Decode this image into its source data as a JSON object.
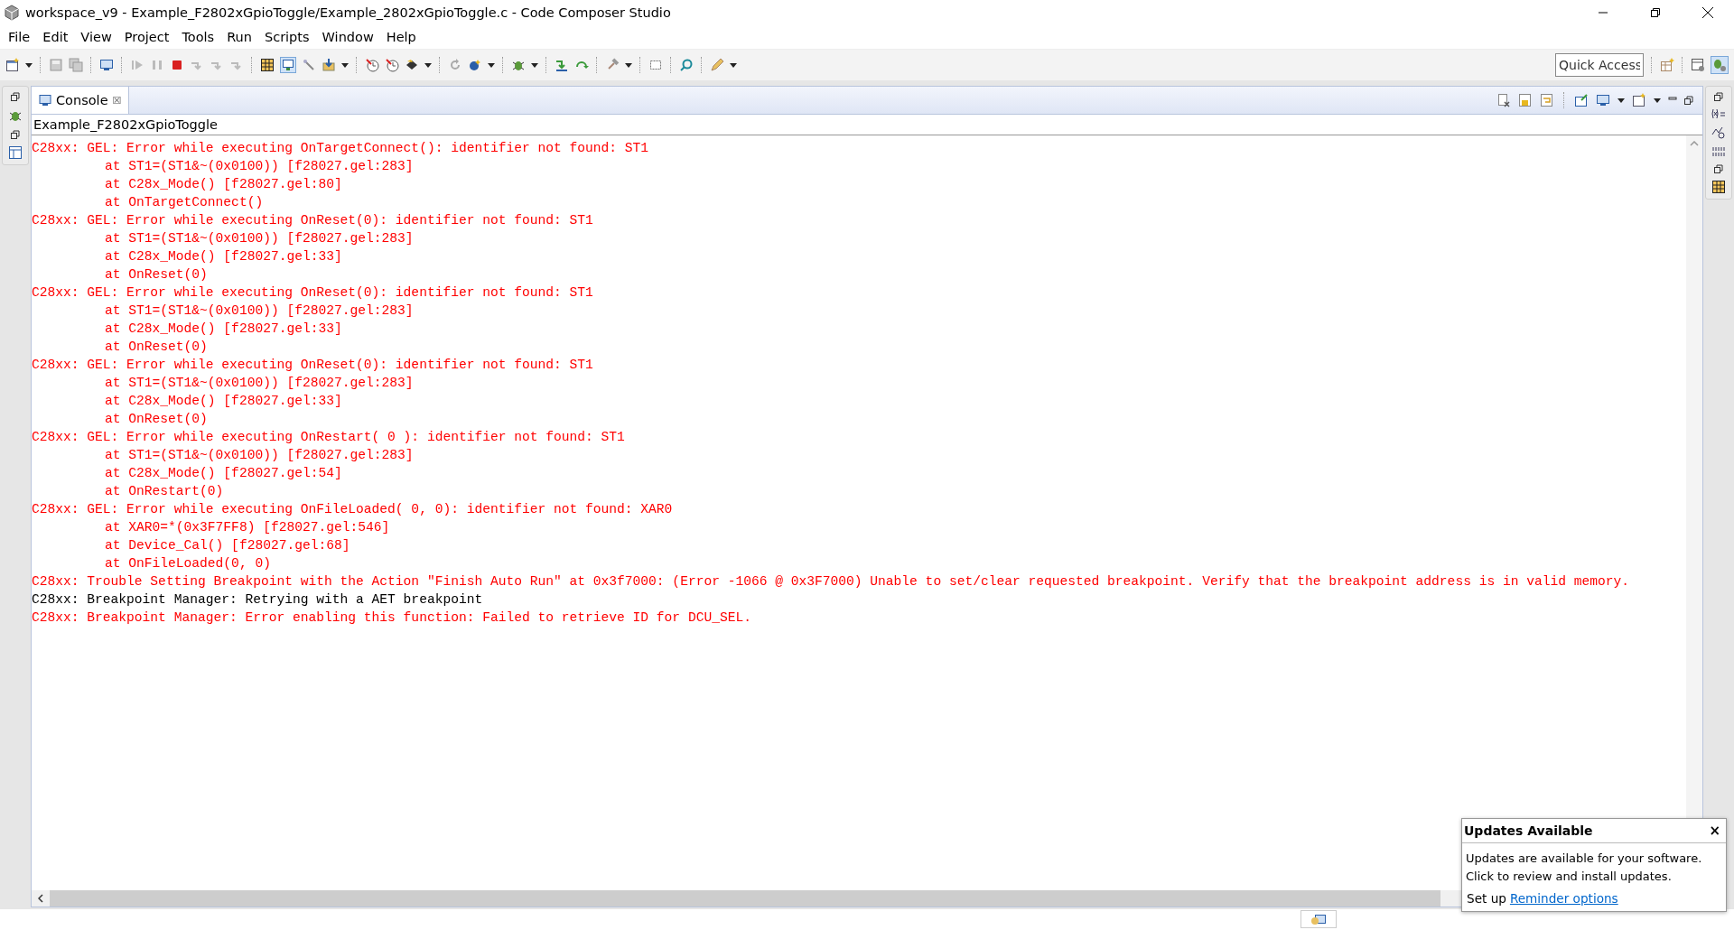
{
  "window": {
    "title": "workspace_v9 - Example_F2802xGpioToggle/Example_2802xGpioToggle.c - Code Composer Studio"
  },
  "menu": [
    "File",
    "Edit",
    "View",
    "Project",
    "Tools",
    "Run",
    "Scripts",
    "Window",
    "Help"
  ],
  "quick_access": {
    "placeholder": "Quick Access"
  },
  "console": {
    "tab": {
      "label": "Console",
      "close": "☒"
    },
    "subtitle": "Example_F2802xGpioToggle",
    "lines": [
      {
        "kind": "error",
        "text": "C28xx: GEL: Error while executing OnTargetConnect(): identifier not found: ST1"
      },
      {
        "kind": "trace",
        "text": "at ST1=(ST1&~(0x0100)) [f28027.gel:283]"
      },
      {
        "kind": "trace",
        "text": "at C28x_Mode() [f28027.gel:80]"
      },
      {
        "kind": "trace",
        "text": "at OnTargetConnect()"
      },
      {
        "kind": "error",
        "text": "C28xx: GEL: Error while executing OnReset(0): identifier not found: ST1"
      },
      {
        "kind": "trace",
        "text": "at ST1=(ST1&~(0x0100)) [f28027.gel:283]"
      },
      {
        "kind": "trace",
        "text": "at C28x_Mode() [f28027.gel:33]"
      },
      {
        "kind": "trace",
        "text": "at OnReset(0)"
      },
      {
        "kind": "error",
        "text": "C28xx: GEL: Error while executing OnReset(0): identifier not found: ST1"
      },
      {
        "kind": "trace",
        "text": "at ST1=(ST1&~(0x0100)) [f28027.gel:283]"
      },
      {
        "kind": "trace",
        "text": "at C28x_Mode() [f28027.gel:33]"
      },
      {
        "kind": "trace",
        "text": "at OnReset(0)"
      },
      {
        "kind": "error",
        "text": "C28xx: GEL: Error while executing OnReset(0): identifier not found: ST1"
      },
      {
        "kind": "trace",
        "text": "at ST1=(ST1&~(0x0100)) [f28027.gel:283]"
      },
      {
        "kind": "trace",
        "text": "at C28x_Mode() [f28027.gel:33]"
      },
      {
        "kind": "trace",
        "text": "at OnReset(0)"
      },
      {
        "kind": "error",
        "text": "C28xx: GEL: Error while executing OnRestart( 0 ): identifier not found: ST1"
      },
      {
        "kind": "trace",
        "text": "at ST1=(ST1&~(0x0100)) [f28027.gel:283]"
      },
      {
        "kind": "trace",
        "text": "at C28x_Mode() [f28027.gel:54]"
      },
      {
        "kind": "trace",
        "text": "at OnRestart(0)"
      },
      {
        "kind": "error",
        "text": "C28xx: GEL: Error while executing OnFileLoaded( 0, 0): identifier not found: XAR0"
      },
      {
        "kind": "trace",
        "text": "at XAR0=*(0x3F7FF8) [f28027.gel:546]"
      },
      {
        "kind": "trace",
        "text": "at Device_Cal() [f28027.gel:68]"
      },
      {
        "kind": "trace",
        "text": "at OnFileLoaded(0, 0)"
      },
      {
        "kind": "error",
        "text": "C28xx: Trouble Setting Breakpoint with the Action \"Finish Auto Run\" at 0x3f7000: (Error -1066 @ 0x3F7000) Unable to set/clear requested breakpoint. Verify that the breakpoint address is in valid memory."
      },
      {
        "kind": "info",
        "text": "C28xx: Breakpoint Manager: Retrying with a AET breakpoint"
      },
      {
        "kind": "error",
        "text": "C28xx: Breakpoint Manager: Error enabling this function: Failed to retrieve ID for DCU_SEL."
      }
    ]
  },
  "notification": {
    "title": "Updates Available",
    "close": "×",
    "body": "Updates are available for your software. Click to review and install updates.",
    "prefix": "Set up",
    "link": "Reminder options"
  }
}
